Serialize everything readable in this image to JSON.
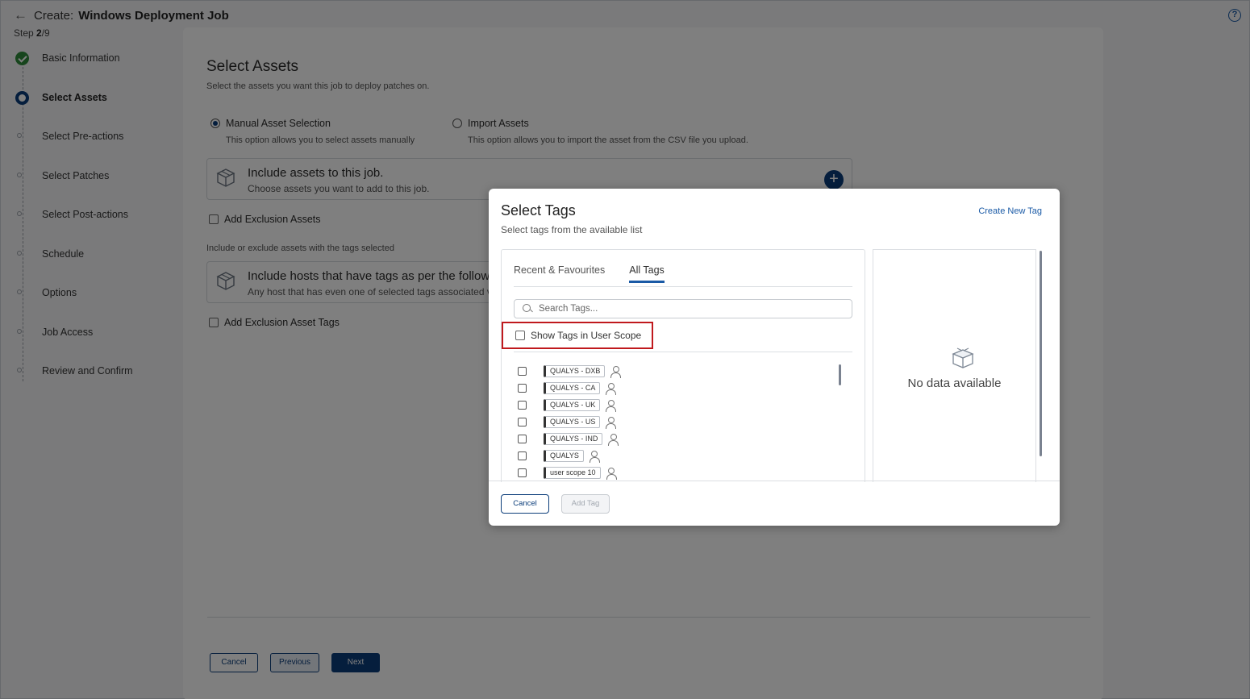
{
  "header": {
    "prefix": "Create:",
    "title": "Windows Deployment Job",
    "step_label": "Step",
    "step_current": "2",
    "step_total": "/9"
  },
  "steps": [
    {
      "label": "Basic Information",
      "state": "done"
    },
    {
      "label": "Select Assets",
      "state": "active"
    },
    {
      "label": "Select Pre-actions",
      "state": "pending"
    },
    {
      "label": "Select Patches",
      "state": "pending"
    },
    {
      "label": "Select Post-actions",
      "state": "pending"
    },
    {
      "label": "Schedule",
      "state": "pending"
    },
    {
      "label": "Options",
      "state": "pending"
    },
    {
      "label": "Job Access",
      "state": "pending"
    },
    {
      "label": "Review and Confirm",
      "state": "pending"
    }
  ],
  "main": {
    "title": "Select Assets",
    "subtitle": "Select the assets you want this job to deploy patches on.",
    "manual_label": "Manual Asset Selection",
    "manual_desc": "This option allows you to select assets manually",
    "import_label": "Import Assets",
    "import_desc": "This option allows you to import the asset from the CSV file you upload.",
    "include_assets_title": "Include assets to this job.",
    "include_assets_sub": "Choose assets you want to add to this job.",
    "add_exclusion_assets": "Add Exclusion Assets",
    "tags_note": "Include or exclude assets with the tags selected",
    "include_hosts_title": "Include hosts that have tags as per the follow",
    "include_hosts_sub": "Any host that has even one of selected tags associated v",
    "add_exclusion_tags": "Add Exclusion Asset Tags",
    "cancel": "Cancel",
    "previous": "Previous",
    "next": "Next"
  },
  "modal": {
    "title": "Select Tags",
    "subtitle": "Select tags from the available list",
    "create_link": "Create New Tag",
    "tab_recent": "Recent & Favourites",
    "tab_all": "All Tags",
    "search_placeholder": "Search Tags...",
    "scope_label": "Show Tags in User Scope",
    "tags": [
      "QUALYS - DXB",
      "QUALYS - CA",
      "QUALYS - UK",
      "QUALYS - US",
      "QUALYS - IND",
      "QUALYS",
      "user scope 10"
    ],
    "no_data": "No data available",
    "cancel": "Cancel",
    "add_tag": "Add Tag"
  },
  "colors": {
    "accent": "#0b3d7a",
    "link": "#1a5aa6",
    "success": "#2e8b3a",
    "highlight": "#c0191d"
  }
}
